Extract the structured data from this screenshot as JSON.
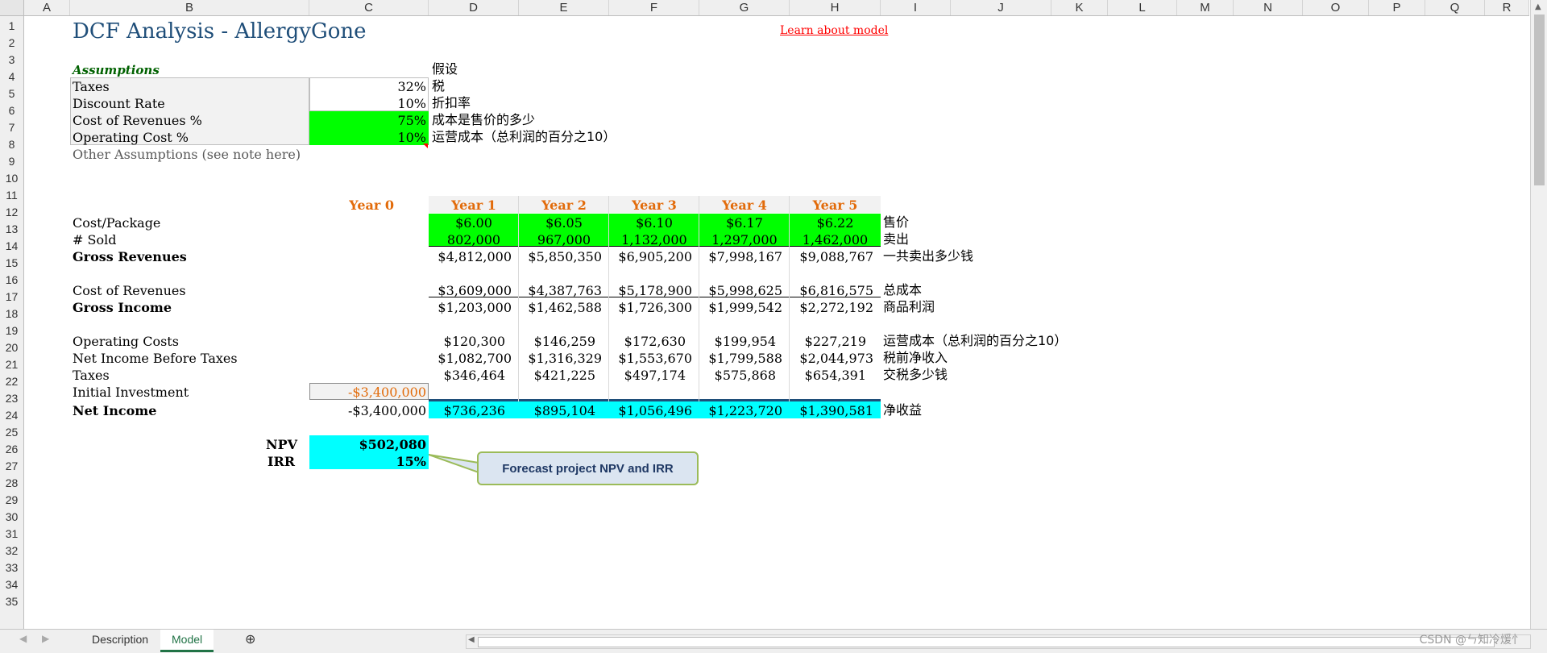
{
  "columns": [
    "A",
    "B",
    "C",
    "D",
    "E",
    "F",
    "G",
    "H",
    "I",
    "J",
    "K",
    "L",
    "M",
    "N",
    "O",
    "P",
    "Q",
    "R"
  ],
  "rows": [
    "1",
    "2",
    "3",
    "4",
    "5",
    "6",
    "7",
    "8",
    "9",
    "10",
    "11",
    "12",
    "13",
    "14",
    "15",
    "16",
    "17",
    "18",
    "19",
    "20",
    "21",
    "22",
    "23",
    "24",
    "25",
    "26",
    "27",
    "28",
    "29",
    "30",
    "31",
    "32",
    "33",
    "34",
    "35"
  ],
  "title": "DCF Analysis - AllergyGone",
  "learn_link": "Learn about model",
  "assumptions": {
    "heading": "Assumptions",
    "heading_zh": "假设",
    "items": [
      {
        "label": "Taxes",
        "value": "32%",
        "zh": "税"
      },
      {
        "label": "Discount Rate",
        "value": "10%",
        "zh": "折扣率"
      },
      {
        "label": "Cost of Revenues %",
        "value": "75%",
        "zh": "成本是售价的多少"
      },
      {
        "label": "Operating Cost %",
        "value": "10%",
        "zh": "运营成本（总利润的百分之10）"
      }
    ],
    "other": "Other Assumptions (see note here)"
  },
  "years": [
    "Year 0",
    "Year 1",
    "Year 2",
    "Year 3",
    "Year 4",
    "Year 5"
  ],
  "table": {
    "cost_package": {
      "label": "Cost/Package",
      "values": [
        "$6.00",
        "$6.05",
        "$6.10",
        "$6.17",
        "$6.22"
      ],
      "zh": "售价"
    },
    "sold": {
      "label": "# Sold",
      "values": [
        "802,000",
        "967,000",
        "1,132,000",
        "1,297,000",
        "1,462,000"
      ],
      "zh": "卖出"
    },
    "gross_revenues": {
      "label": "Gross Revenues",
      "values": [
        "$4,812,000",
        "$5,850,350",
        "$6,905,200",
        "$7,998,167",
        "$9,088,767"
      ],
      "zh": "一共卖出多少钱"
    },
    "cost_revenues": {
      "label": "Cost of Revenues",
      "values": [
        "$3,609,000",
        "$4,387,763",
        "$5,178,900",
        "$5,998,625",
        "$6,816,575"
      ],
      "zh": "总成本"
    },
    "gross_income": {
      "label": "Gross Income",
      "values": [
        "$1,203,000",
        "$1,462,588",
        "$1,726,300",
        "$1,999,542",
        "$2,272,192"
      ],
      "zh": "商品利润"
    },
    "operating_costs": {
      "label": "Operating Costs",
      "values": [
        "$120,300",
        "$146,259",
        "$172,630",
        "$199,954",
        "$227,219"
      ],
      "zh": "运营成本（总利润的百分之10）"
    },
    "net_before_tax": {
      "label": "Net Income Before Taxes",
      "values": [
        "$1,082,700",
        "$1,316,329",
        "$1,553,670",
        "$1,799,588",
        "$2,044,973"
      ],
      "zh": "税前净收入"
    },
    "taxes": {
      "label": "Taxes",
      "values": [
        "$346,464",
        "$421,225",
        "$497,174",
        "$575,868",
        "$654,391"
      ],
      "zh": "交税多少钱"
    },
    "initial_investment": {
      "label": "Initial Investment",
      "value": "-$3,400,000"
    },
    "net_income": {
      "label": "Net Income",
      "year0": "-$3,400,000",
      "values": [
        "$736,236",
        "$895,104",
        "$1,056,496",
        "$1,223,720",
        "$1,390,581"
      ],
      "zh": "净收益"
    }
  },
  "npv": {
    "label": "NPV",
    "value": "$502,080"
  },
  "irr": {
    "label": "IRR",
    "value": "15%"
  },
  "callout": "Forecast project NPV and IRR",
  "tabs": {
    "description": "Description",
    "model": "Model",
    "add": "⊕"
  },
  "watermark": "CSDN @ㄣ知冷煖忄"
}
